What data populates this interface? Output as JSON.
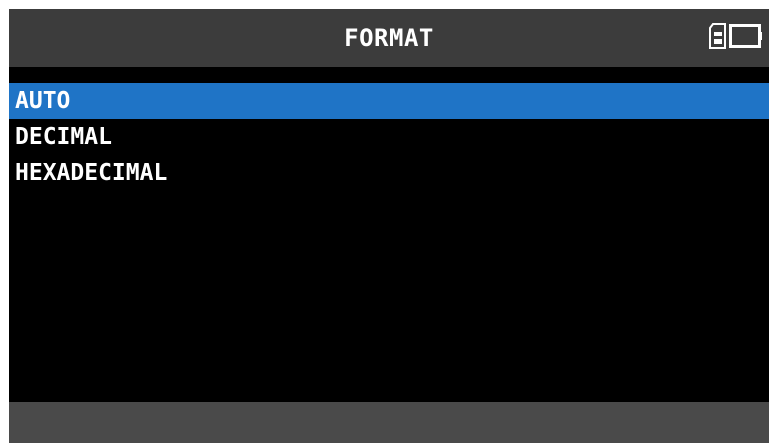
{
  "header": {
    "title": "FORMAT",
    "icons": [
      "sd-card-icon",
      "battery-icon"
    ]
  },
  "menu": {
    "selected_index": 0,
    "items": [
      {
        "label": "AUTO"
      },
      {
        "label": "DECIMAL"
      },
      {
        "label": "HEXADECIMAL"
      }
    ]
  },
  "colors": {
    "header_bg": "#3c3c3c",
    "screen_bg": "#000000",
    "selection": "#1f74c6",
    "footer_bg": "#4a4a4a",
    "text": "#ffffff"
  }
}
